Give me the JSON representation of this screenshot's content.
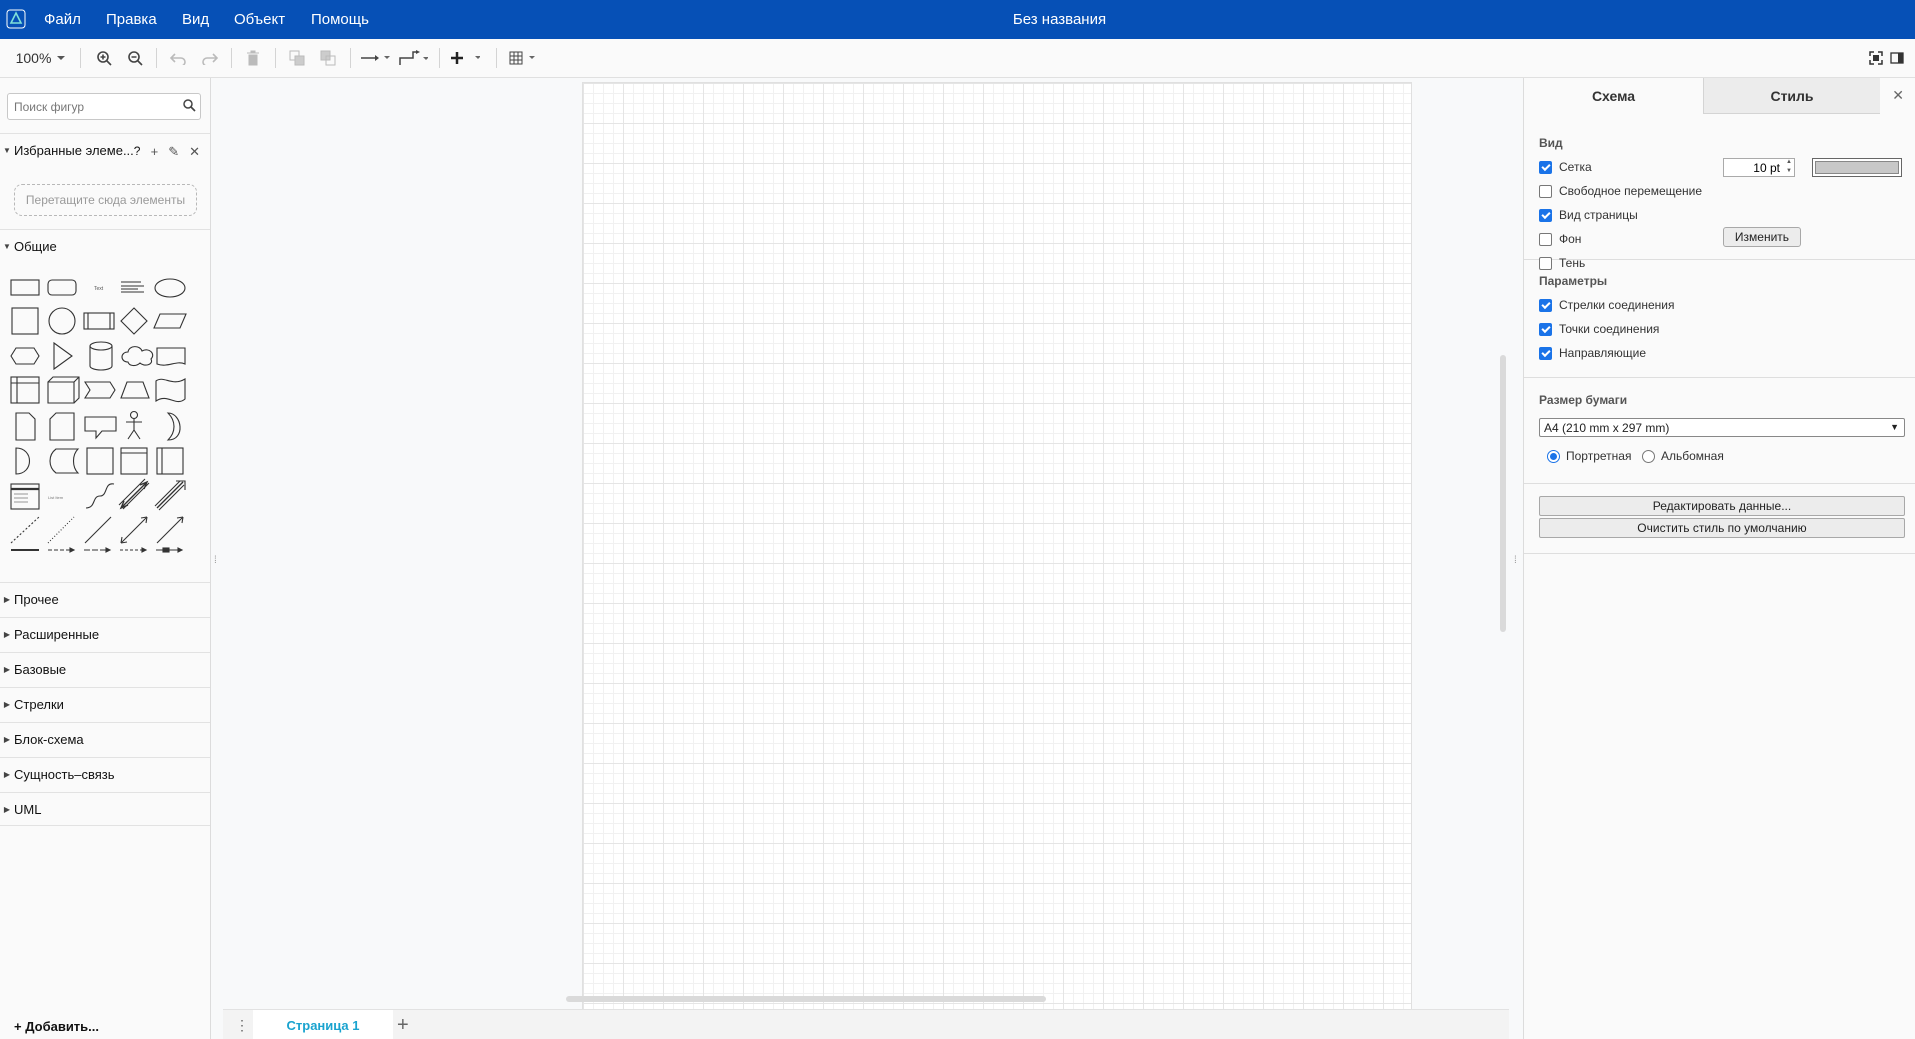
{
  "menubar": {
    "items": [
      "Файл",
      "Правка",
      "Вид",
      "Объект",
      "Помощь"
    ],
    "title": "Без названия",
    "bg_color": "#0650b6"
  },
  "toolbar": {
    "zoom": "100%"
  },
  "left": {
    "search_placeholder": "Поиск фигур",
    "favorites_label": "Избранные элеме...",
    "favorites_help": "?",
    "dropzone_text": "Перетащите сюда элементы",
    "general_label": "Общие",
    "shape_text_label": "Text",
    "shape_list_label": "List Item",
    "sections": [
      "Прочее",
      "Расширенные",
      "Базовые",
      "Стрелки",
      "Блок-схема",
      "Сущность–связь",
      "UML"
    ],
    "add_more": "+ Добавить..."
  },
  "pages": {
    "current": "Страница 1"
  },
  "right": {
    "tabs": [
      "Схема",
      "Стиль"
    ],
    "view_title": "Вид",
    "view_options": [
      {
        "label": "Сетка",
        "checked": true
      },
      {
        "label": "Свободное перемещение",
        "checked": false
      },
      {
        "label": "Вид страницы",
        "checked": true
      },
      {
        "label": "Фон",
        "checked": false
      },
      {
        "label": "Тень",
        "checked": false
      }
    ],
    "grid_size": "10 pt",
    "grid_color": "#c8c8c8",
    "change_button": "Изменить",
    "options_title": "Параметры",
    "options": [
      {
        "label": "Стрелки соединения",
        "checked": true
      },
      {
        "label": "Точки соединения",
        "checked": true
      },
      {
        "label": "Направляющие",
        "checked": true
      }
    ],
    "paper_title": "Размер бумаги",
    "paper_size": "A4 (210 mm x 297 mm)",
    "orientation": [
      {
        "label": "Портретная",
        "selected": true
      },
      {
        "label": "Альбомная",
        "selected": false
      }
    ],
    "edit_data_button": "Редактировать данные...",
    "clear_style_button": "Очистить стиль по умолчанию"
  }
}
